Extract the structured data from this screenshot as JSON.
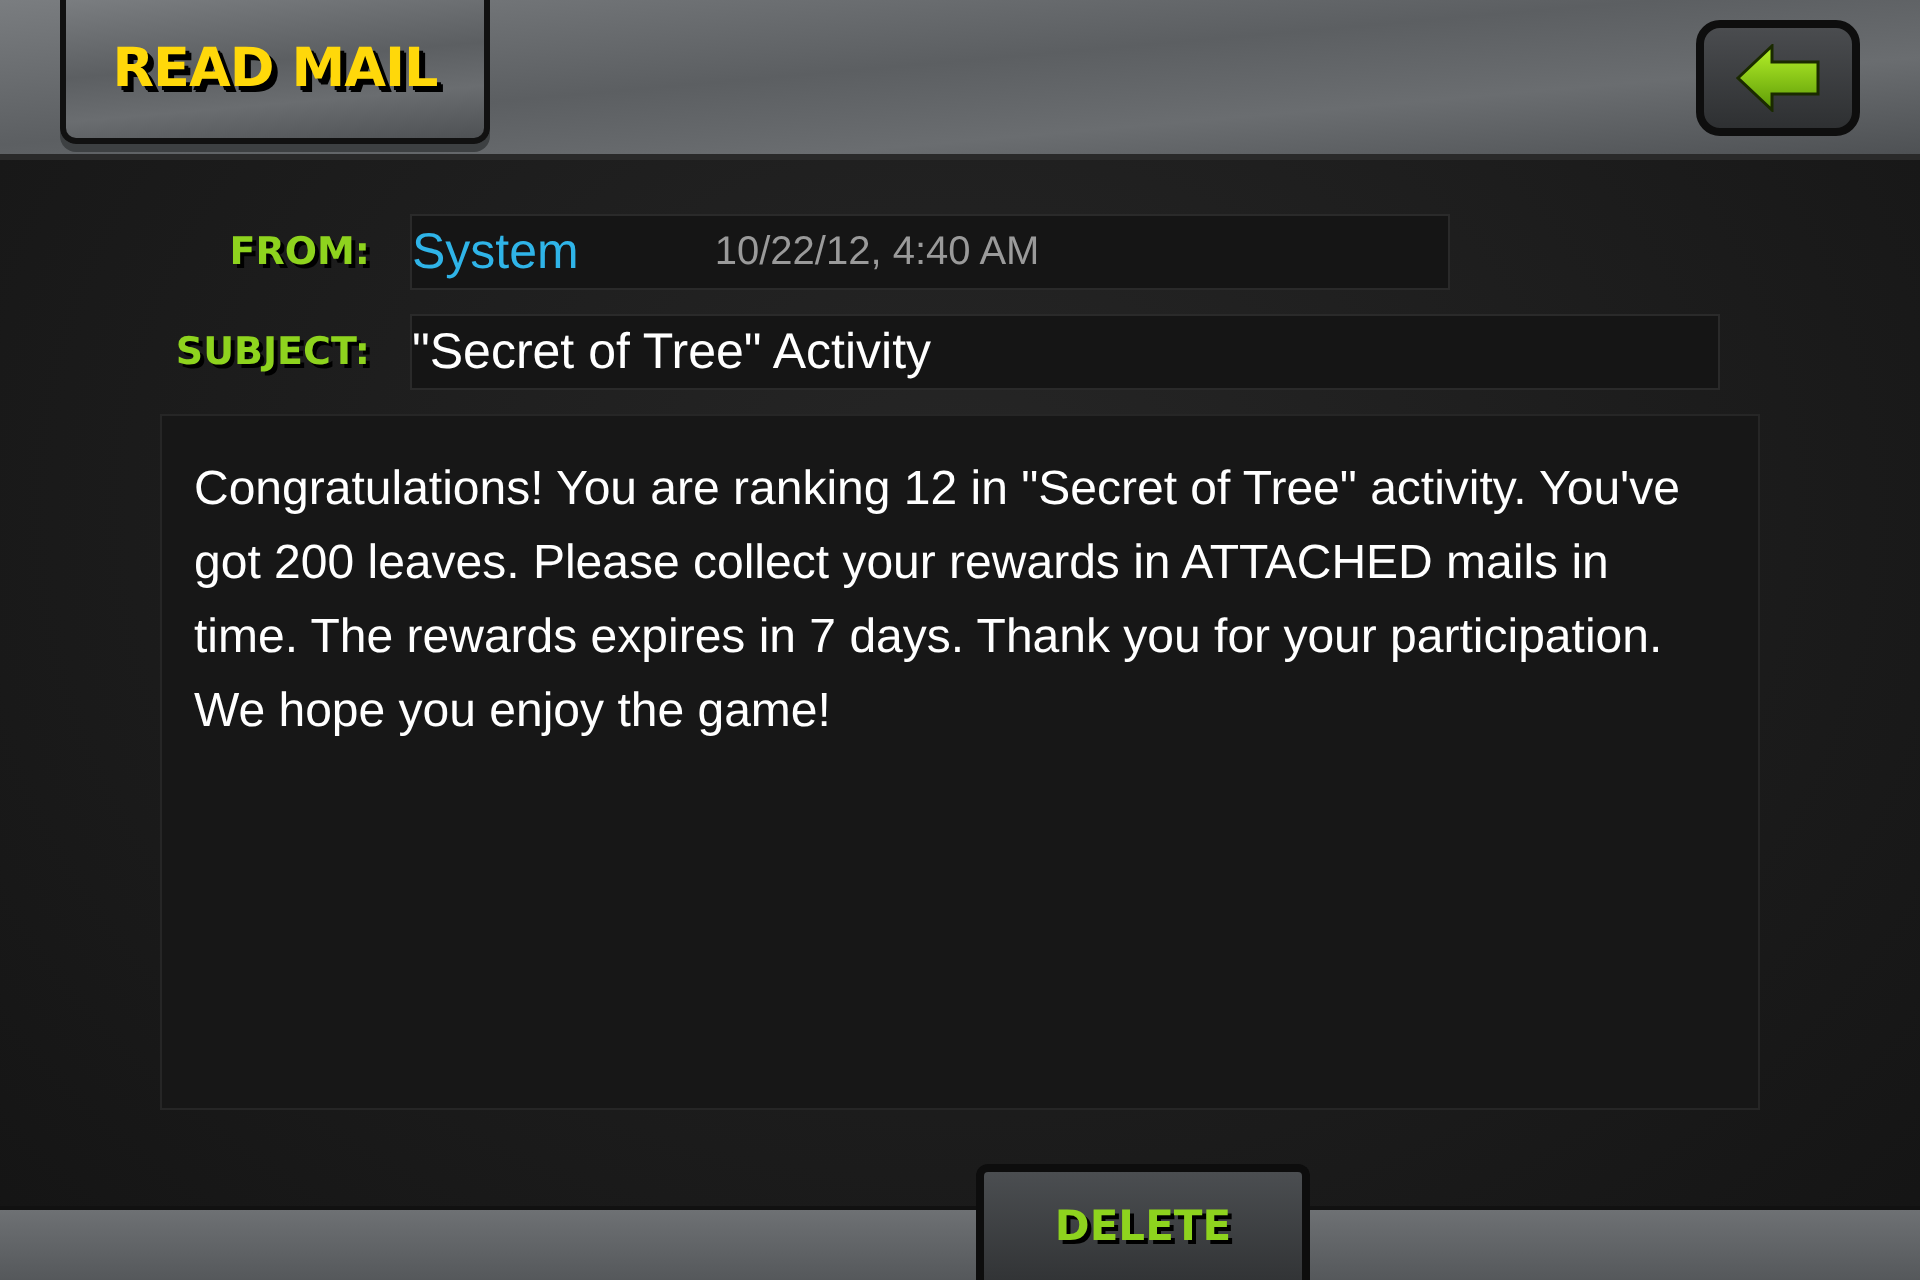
{
  "header": {
    "title": "READ MAIL"
  },
  "fields": [
    {
      "label": "FROM:",
      "value": "System",
      "date": "10/22/12, 4:40 AM"
    },
    {
      "label": "SUBJECT:",
      "value": "\"Secret of Tree\" Activity"
    }
  ],
  "message": "Congratulations! You are ranking 12 in \"Secret of Tree\" activity. You've got 200 leaves. Please collect your rewards in ATTACHED mails in time. The rewards expires in 7 days. Thank you for your participation. We hope you enjoy the game!",
  "actions": [
    {
      "label": "DELETE"
    }
  ]
}
